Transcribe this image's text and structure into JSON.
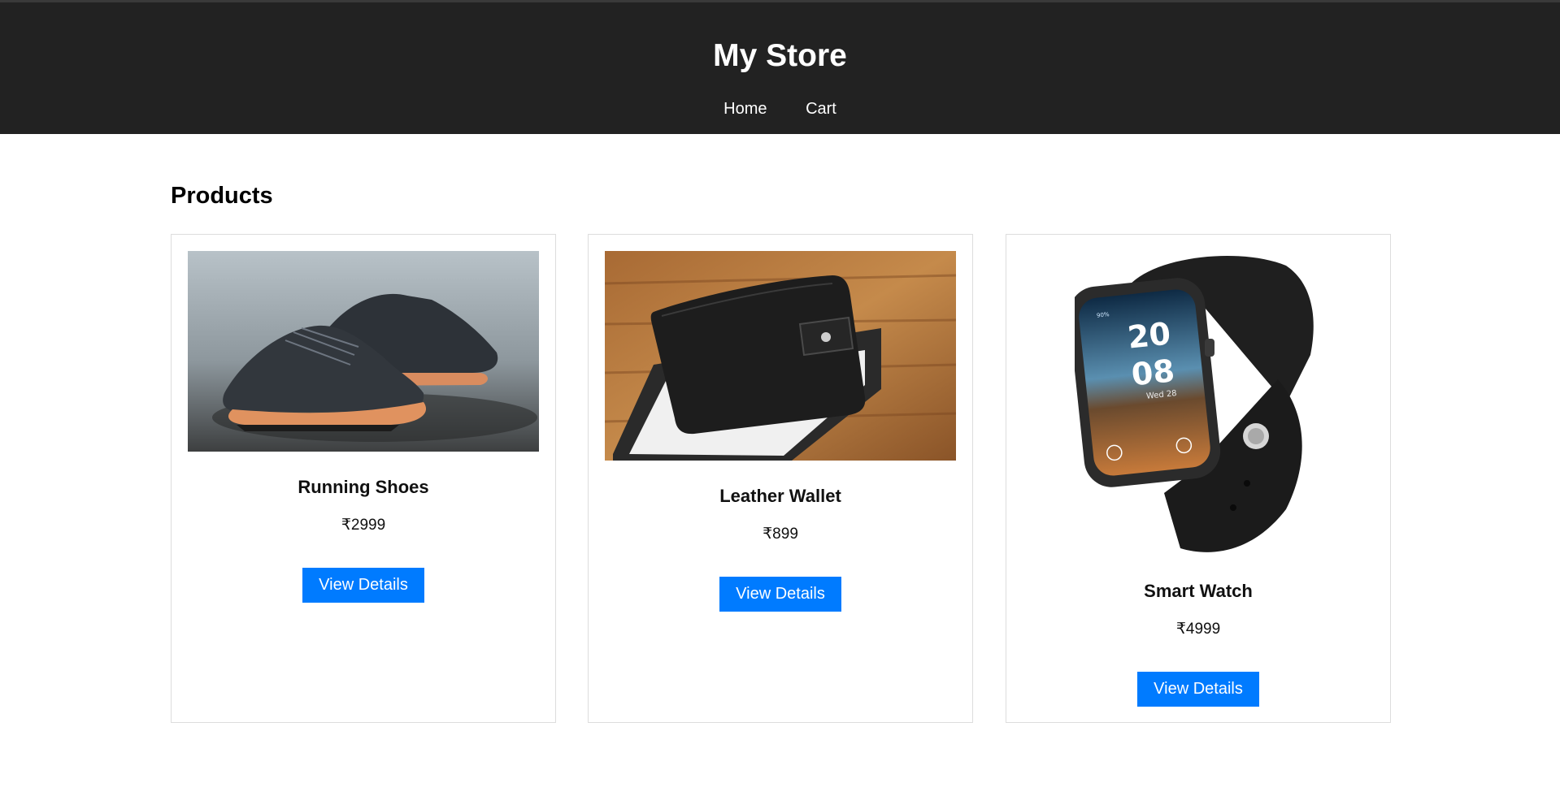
{
  "header": {
    "title": "My Store",
    "nav": [
      "Home",
      "Cart"
    ]
  },
  "main": {
    "section_title": "Products",
    "products": [
      {
        "name": "Running Shoes",
        "price": "₹2999",
        "button": "View Details",
        "image_alt": "running-shoes-photo"
      },
      {
        "name": "Leather Wallet",
        "price": "₹899",
        "button": "View Details",
        "image_alt": "leather-wallet-photo"
      },
      {
        "name": "Smart Watch",
        "price": "₹4999",
        "button": "View Details",
        "image_alt": "smart-watch-photo",
        "watch_face": {
          "hour": "20",
          "minute": "08",
          "date": "Wed 28",
          "battery": "90%"
        }
      }
    ]
  },
  "colors": {
    "header_bg": "#222222",
    "accent": "#007bff",
    "card_border": "#dddddd"
  }
}
